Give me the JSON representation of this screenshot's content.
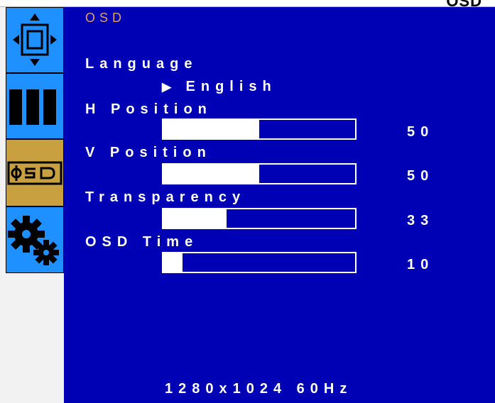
{
  "menu_title": "OSD",
  "cut_text": "OSD",
  "colors": {
    "panel": "#0000b4",
    "title": "#e0a060",
    "tab_active": "#c8a040",
    "tab_inactive": "#1e90ff"
  },
  "tabs": [
    {
      "name": "image-position",
      "icon": "position-icon",
      "active": false
    },
    {
      "name": "color",
      "icon": "color-bars-icon",
      "active": false
    },
    {
      "name": "osd",
      "icon": "osd-icon",
      "active": true
    },
    {
      "name": "settings",
      "icon": "gears-icon",
      "active": false
    }
  ],
  "language": {
    "label": "Language",
    "value": "English",
    "marker": "▶"
  },
  "settings": [
    {
      "label": "H Position",
      "value": 50,
      "display": "50"
    },
    {
      "label": "V Position",
      "value": 50,
      "display": "50"
    },
    {
      "label": "Transparency",
      "value": 33,
      "display": "33"
    },
    {
      "label": "OSD Time",
      "value": 10,
      "display": "10"
    }
  ],
  "status": "1280x1024 60Hz"
}
